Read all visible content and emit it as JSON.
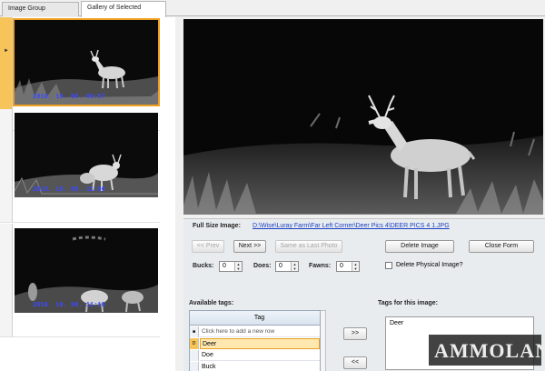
{
  "tabs": [
    {
      "label": "Image Group Selection"
    },
    {
      "label": "Gallery of Selected Images"
    }
  ],
  "gallery": {
    "items": [
      {
        "timestamp": "2010. 10. 08. 06:57"
      },
      {
        "timestamp": "2010. 10. 08. 11:06"
      },
      {
        "timestamp": "2010. 10. 08. 11:10"
      }
    ]
  },
  "details": {
    "full_size_label": "Full Size Image:",
    "full_size_path": "D:\\Wise\\Luray Farm\\Far Left Corner\\Deer Pics 4\\DEER PICS 4 1.JPG",
    "prev_label": "<< Prev",
    "next_label": "Next >>",
    "same_as_last_label": "Same as Last Photo",
    "delete_image_label": "Delete Image",
    "close_form_label": "Close Form",
    "bucks_label": "Bucks:",
    "bucks_value": "0",
    "does_label": "Does:",
    "does_value": "0",
    "fawns_label": "Fawns:",
    "fawns_value": "0",
    "delete_physical_label": "Delete Physical Image?"
  },
  "tags": {
    "available_label": "Available tags:",
    "column_header": "Tag",
    "new_row_hint": "Click here to add a new row",
    "rows": [
      "Deer",
      "Doe",
      "Buck"
    ],
    "selected_row_marker": "D",
    "add_label": ">>",
    "remove_label": "<<",
    "for_image_label": "Tags for this image:",
    "for_image": [
      "Deer"
    ]
  },
  "watermark": {
    "text": "AMMOLAND"
  },
  "colors": {
    "selection": "#f7c45a",
    "timestamp": "#3b49ff",
    "link": "#1b3fc2"
  }
}
